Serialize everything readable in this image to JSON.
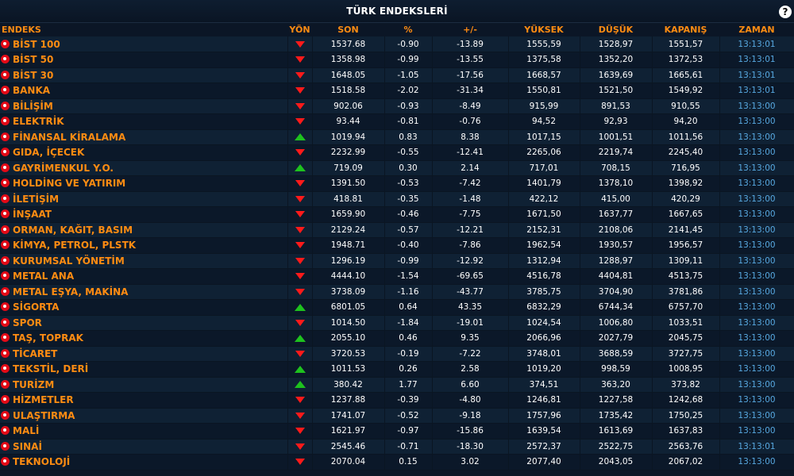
{
  "header": {
    "title": "TÜRK ENDEKSLERİ",
    "help_label": "?"
  },
  "columns": {
    "name": "ENDEKS",
    "dir": "YÖN",
    "last": "SON",
    "pct": "%",
    "chg": "+/-",
    "high": "YÜKSEK",
    "low": "DÜŞÜK",
    "close": "KAPANIŞ",
    "time": "ZAMAN"
  },
  "colors": {
    "accent": "#ff8c12",
    "down": "#ff1a1a",
    "up": "#1ec21e",
    "time": "#57a8e0",
    "flag": "#e30a17"
  },
  "rows": [
    {
      "name": "BİST 100",
      "dir": "down",
      "last": "1537.68",
      "pct": "-0.90",
      "chg": "-13.89",
      "high": "1555,59",
      "low": "1528,97",
      "close": "1551,57",
      "time": "13:13:01"
    },
    {
      "name": "BİST 50",
      "dir": "down",
      "last": "1358.98",
      "pct": "-0.99",
      "chg": "-13.55",
      "high": "1375,58",
      "low": "1352,20",
      "close": "1372,53",
      "time": "13:13:01"
    },
    {
      "name": "BİST 30",
      "dir": "down",
      "last": "1648.05",
      "pct": "-1.05",
      "chg": "-17.56",
      "high": "1668,57",
      "low": "1639,69",
      "close": "1665,61",
      "time": "13:13:01"
    },
    {
      "name": "BANKA",
      "dir": "down",
      "last": "1518.58",
      "pct": "-2.02",
      "chg": "-31.34",
      "high": "1550,81",
      "low": "1521,50",
      "close": "1549,92",
      "time": "13:13:01"
    },
    {
      "name": "BİLİŞİM",
      "dir": "down",
      "last": "902.06",
      "pct": "-0.93",
      "chg": "-8.49",
      "high": "915,99",
      "low": "891,53",
      "close": "910,55",
      "time": "13:13:00"
    },
    {
      "name": "ELEKTRİK",
      "dir": "down",
      "last": "93.44",
      "pct": "-0.81",
      "chg": "-0.76",
      "high": "94,52",
      "low": "92,93",
      "close": "94,20",
      "time": "13:13:00"
    },
    {
      "name": "FİNANSAL KİRALAMA",
      "dir": "up",
      "last": "1019.94",
      "pct": "0.83",
      "chg": "8.38",
      "high": "1017,15",
      "low": "1001,51",
      "close": "1011,56",
      "time": "13:13:00"
    },
    {
      "name": "GIDA, İÇECEK",
      "dir": "down",
      "last": "2232.99",
      "pct": "-0.55",
      "chg": "-12.41",
      "high": "2265,06",
      "low": "2219,74",
      "close": "2245,40",
      "time": "13:13:00"
    },
    {
      "name": "GAYRİMENKUL Y.O.",
      "dir": "up",
      "last": "719.09",
      "pct": "0.30",
      "chg": "2.14",
      "high": "717,01",
      "low": "708,15",
      "close": "716,95",
      "time": "13:13:00"
    },
    {
      "name": "HOLDİNG VE YATIRIM",
      "dir": "down",
      "last": "1391.50",
      "pct": "-0.53",
      "chg": "-7.42",
      "high": "1401,79",
      "low": "1378,10",
      "close": "1398,92",
      "time": "13:13:00"
    },
    {
      "name": "İLETİŞİM",
      "dir": "down",
      "last": "418.81",
      "pct": "-0.35",
      "chg": "-1.48",
      "high": "422,12",
      "low": "415,00",
      "close": "420,29",
      "time": "13:13:00"
    },
    {
      "name": "İNŞAAT",
      "dir": "down",
      "last": "1659.90",
      "pct": "-0.46",
      "chg": "-7.75",
      "high": "1671,50",
      "low": "1637,77",
      "close": "1667,65",
      "time": "13:13:00"
    },
    {
      "name": "ORMAN, KAĞIT, BASIM",
      "dir": "down",
      "last": "2129.24",
      "pct": "-0.57",
      "chg": "-12.21",
      "high": "2152,31",
      "low": "2108,06",
      "close": "2141,45",
      "time": "13:13:00"
    },
    {
      "name": "KİMYA, PETROL, PLSTK",
      "dir": "down",
      "last": "1948.71",
      "pct": "-0.40",
      "chg": "-7.86",
      "high": "1962,54",
      "low": "1930,57",
      "close": "1956,57",
      "time": "13:13:00"
    },
    {
      "name": "KURUMSAL YÖNETİM",
      "dir": "down",
      "last": "1296.19",
      "pct": "-0.99",
      "chg": "-12.92",
      "high": "1312,94",
      "low": "1288,97",
      "close": "1309,11",
      "time": "13:13:00"
    },
    {
      "name": "METAL ANA",
      "dir": "down",
      "last": "4444.10",
      "pct": "-1.54",
      "chg": "-69.65",
      "high": "4516,78",
      "low": "4404,81",
      "close": "4513,75",
      "time": "13:13:00"
    },
    {
      "name": "METAL EŞYA, MAKİNA",
      "dir": "down",
      "last": "3738.09",
      "pct": "-1.16",
      "chg": "-43.77",
      "high": "3785,75",
      "low": "3704,90",
      "close": "3781,86",
      "time": "13:13:00"
    },
    {
      "name": "SİGORTA",
      "dir": "up",
      "last": "6801.05",
      "pct": "0.64",
      "chg": "43.35",
      "high": "6832,29",
      "low": "6744,34",
      "close": "6757,70",
      "time": "13:13:00"
    },
    {
      "name": "SPOR",
      "dir": "down",
      "last": "1014.50",
      "pct": "-1.84",
      "chg": "-19.01",
      "high": "1024,54",
      "low": "1006,80",
      "close": "1033,51",
      "time": "13:13:00"
    },
    {
      "name": "TAŞ, TOPRAK",
      "dir": "up",
      "last": "2055.10",
      "pct": "0.46",
      "chg": "9.35",
      "high": "2066,96",
      "low": "2027,79",
      "close": "2045,75",
      "time": "13:13:00"
    },
    {
      "name": "TİCARET",
      "dir": "down",
      "last": "3720.53",
      "pct": "-0.19",
      "chg": "-7.22",
      "high": "3748,01",
      "low": "3688,59",
      "close": "3727,75",
      "time": "13:13:00"
    },
    {
      "name": "TEKSTİL, DERİ",
      "dir": "up",
      "last": "1011.53",
      "pct": "0.26",
      "chg": "2.58",
      "high": "1019,20",
      "low": "998,59",
      "close": "1008,95",
      "time": "13:13:00"
    },
    {
      "name": "TURİZM",
      "dir": "up",
      "last": "380.42",
      "pct": "1.77",
      "chg": "6.60",
      "high": "374,51",
      "low": "363,20",
      "close": "373,82",
      "time": "13:13:00"
    },
    {
      "name": "HİZMETLER",
      "dir": "down",
      "last": "1237.88",
      "pct": "-0.39",
      "chg": "-4.80",
      "high": "1246,81",
      "low": "1227,58",
      "close": "1242,68",
      "time": "13:13:00"
    },
    {
      "name": "ULAŞTIRMA",
      "dir": "down",
      "last": "1741.07",
      "pct": "-0.52",
      "chg": "-9.18",
      "high": "1757,96",
      "low": "1735,42",
      "close": "1750,25",
      "time": "13:13:00"
    },
    {
      "name": "MALİ",
      "dir": "down",
      "last": "1621.97",
      "pct": "-0.97",
      "chg": "-15.86",
      "high": "1639,54",
      "low": "1613,69",
      "close": "1637,83",
      "time": "13:13:00"
    },
    {
      "name": "SINAİ",
      "dir": "down",
      "last": "2545.46",
      "pct": "-0.71",
      "chg": "-18.30",
      "high": "2572,37",
      "low": "2522,75",
      "close": "2563,76",
      "time": "13:13:01"
    },
    {
      "name": "TEKNOLOJİ",
      "dir": "down",
      "last": "2070.04",
      "pct": "0.15",
      "chg": "3.02",
      "high": "2077,40",
      "low": "2043,05",
      "close": "2067,02",
      "time": "13:13:00"
    }
  ]
}
